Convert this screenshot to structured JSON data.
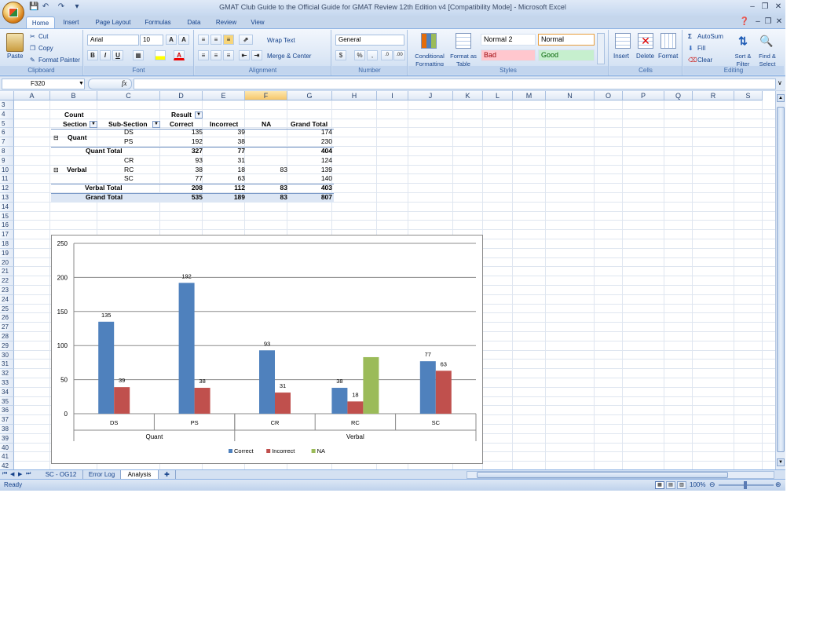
{
  "window": {
    "title": "GMAT Club Guide to the Official Guide for GMAT Review 12th Edition v4  [Compatibility Mode] - Microsoft Excel"
  },
  "tabs": [
    "Home",
    "Insert",
    "Page Layout",
    "Formulas",
    "Data",
    "Review",
    "View"
  ],
  "ribbon": {
    "clipboard": {
      "paste": "Paste",
      "cut": "Cut",
      "copy": "Copy",
      "format_painter": "Format Painter",
      "label": "Clipboard"
    },
    "font": {
      "name": "Arial",
      "size": "10",
      "label": "Font",
      "bold": "B",
      "italic": "I",
      "underline": "U"
    },
    "alignment": {
      "wrap": "Wrap Text",
      "merge": "Merge & Center",
      "label": "Alignment"
    },
    "number": {
      "format": "General",
      "currency": "$",
      "percent": "%",
      "comma": ",",
      "inc": ".0",
      "dec": ".00",
      "label": "Number"
    },
    "styles": {
      "conditional": "Conditional Formatting",
      "format_table": "Format as Table",
      "normal2": "Normal 2",
      "normal": "Normal",
      "bad": "Bad",
      "good": "Good",
      "label": "Styles"
    },
    "cells": {
      "insert": "Insert",
      "delete": "Delete",
      "format": "Format",
      "label": "Cells"
    },
    "editing": {
      "autosum": "AutoSum",
      "fill": "Fill",
      "clear": "Clear",
      "sort": "Sort & Filter",
      "find": "Find & Select",
      "label": "Editing"
    }
  },
  "formula_bar": {
    "name_box": "F320",
    "fx": "fx",
    "content": ""
  },
  "columns": [
    "A",
    "B",
    "C",
    "D",
    "E",
    "F",
    "G",
    "H",
    "I",
    "J",
    "K",
    "L",
    "M",
    "N",
    "O",
    "P",
    "Q",
    "R",
    "S"
  ],
  "rows": [
    "3",
    "4",
    "5",
    "6",
    "7",
    "8",
    "9",
    "10",
    "11",
    "12",
    "13",
    "14",
    "15",
    "16",
    "17",
    "18",
    "19",
    "20",
    "21",
    "22",
    "23",
    "24",
    "25",
    "26",
    "27",
    "28",
    "29",
    "30",
    "31",
    "32",
    "33",
    "34",
    "35",
    "36",
    "37",
    "38",
    "39",
    "40",
    "41",
    "42"
  ],
  "pivot": {
    "count": "Count",
    "section": "Section",
    "subsection": "Sub-Section",
    "result": "Result",
    "headers": [
      "Correct",
      "Incorrect",
      "NA",
      "Grand Total"
    ],
    "quant": "Quant",
    "verbal": "Verbal",
    "rows": [
      {
        "sub": "DS",
        "v": [
          "135",
          "39",
          "",
          "174"
        ]
      },
      {
        "sub": "PS",
        "v": [
          "192",
          "38",
          "",
          "230"
        ]
      },
      {
        "label": "Quant Total",
        "v": [
          "327",
          "77",
          "",
          "404"
        ]
      },
      {
        "sub": "CR",
        "v": [
          "93",
          "31",
          "",
          "124"
        ]
      },
      {
        "sub": "RC",
        "v": [
          "38",
          "18",
          "83",
          "139"
        ]
      },
      {
        "sub": "SC",
        "v": [
          "77",
          "63",
          "",
          "140"
        ]
      },
      {
        "label": "Verbal Total",
        "v": [
          "208",
          "112",
          "83",
          "403"
        ]
      },
      {
        "label": "Grand Total",
        "v": [
          "535",
          "189",
          "83",
          "807"
        ]
      }
    ]
  },
  "chart_data": {
    "type": "bar",
    "categories": [
      "DS",
      "PS",
      "CR",
      "RC",
      "SC"
    ],
    "groups": [
      {
        "name": "Quant",
        "categories": [
          "DS",
          "PS"
        ]
      },
      {
        "name": "Verbal",
        "categories": [
          "CR",
          "RC",
          "SC"
        ]
      }
    ],
    "series": [
      {
        "name": "Correct",
        "color": "#4f81bd",
        "values": [
          135,
          192,
          93,
          38,
          77
        ]
      },
      {
        "name": "Incorrect",
        "color": "#c0504d",
        "values": [
          39,
          38,
          31,
          18,
          63
        ]
      },
      {
        "name": "NA",
        "color": "#9bbb59",
        "values": [
          null,
          null,
          null,
          83,
          null
        ]
      }
    ],
    "ylim": [
      0,
      250
    ],
    "yticks": [
      0,
      50,
      100,
      150,
      200,
      250
    ],
    "grid": true,
    "legend": "bottom"
  },
  "sheets": [
    "SC - OG12",
    "Error Log",
    "Analysis"
  ],
  "status": {
    "text": "Ready",
    "zoom": "100%"
  }
}
